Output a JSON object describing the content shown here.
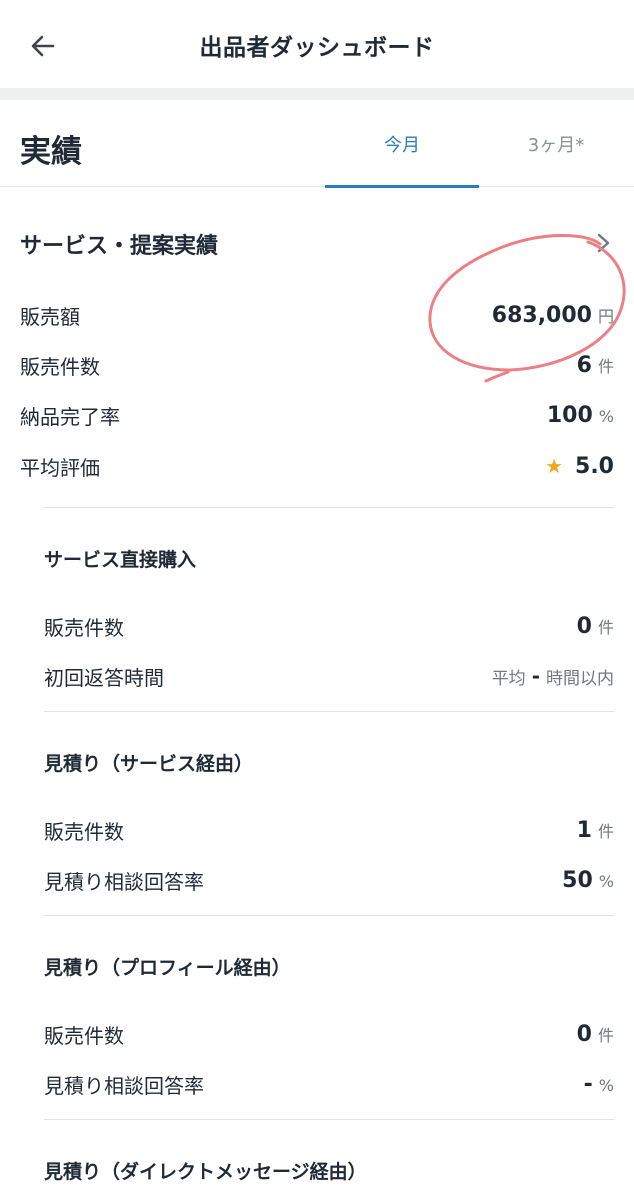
{
  "header": {
    "title": "出品者ダッシュボード",
    "back_icon": "arrow-left-icon"
  },
  "performance": {
    "title": "実績",
    "tabs": [
      {
        "label": "今月",
        "active": true
      },
      {
        "label": "3ヶ月*",
        "active": false
      }
    ]
  },
  "service_results": {
    "title": "サービス・提案実績",
    "rows": [
      {
        "label": "販売額",
        "value": "683,000",
        "unit": "円"
      },
      {
        "label": "販売件数",
        "value": "6",
        "unit": "件"
      },
      {
        "label": "納品完了率",
        "value": "100",
        "unit": "%"
      },
      {
        "label": "平均評価",
        "value": "5.0",
        "unit": ""
      }
    ]
  },
  "direct_purchase": {
    "title": "サービス直接購入",
    "sales_count_label": "販売件数",
    "sales_count_value": "0",
    "sales_count_unit": "件",
    "response_label": "初回返答時間",
    "response_prefix": "平均",
    "response_value": "-",
    "response_suffix": "時間以内"
  },
  "estimate_service": {
    "title": "見積り（サービス経由）",
    "rows": [
      {
        "label": "販売件数",
        "value": "1",
        "unit": "件"
      },
      {
        "label": "見積り相談回答率",
        "value": "50",
        "unit": "%"
      }
    ]
  },
  "estimate_profile": {
    "title": "見積り（プロフィール経由）",
    "rows": [
      {
        "label": "販売件数",
        "value": "0",
        "unit": "件"
      },
      {
        "label": "見積り相談回答率",
        "value": "-",
        "unit": "%"
      }
    ]
  },
  "estimate_dm": {
    "title": "見積り（ダイレクトメッセージ経由）"
  },
  "colors": {
    "accent": "#2c7bbf",
    "star": "#f5a623",
    "annotation": "#ec7f86"
  }
}
